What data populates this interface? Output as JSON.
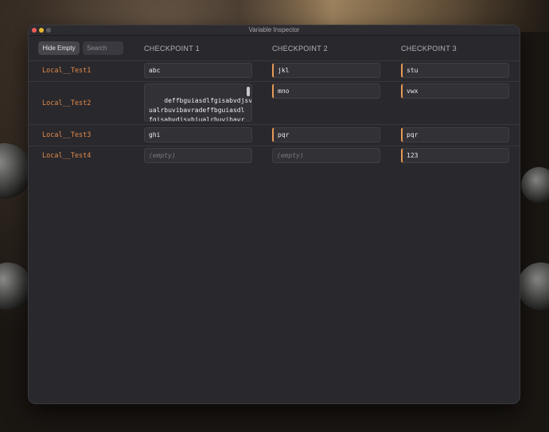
{
  "window": {
    "title": "Variable Inspector"
  },
  "toolbar": {
    "hide_empty_label": "Hide Empty",
    "search_placeholder": "Search",
    "search_value": ""
  },
  "columns": [
    "CHECKPOINT 1",
    "CHECKPOINT 2",
    "CHECKPOINT 3"
  ],
  "rows": [
    {
      "name": "Local__Test1",
      "cells": [
        {
          "value": "abc",
          "changed": false
        },
        {
          "value": "jkl",
          "changed": true
        },
        {
          "value": "stu",
          "changed": true
        }
      ]
    },
    {
      "name": "Local__Test2",
      "cells": [
        {
          "value": "deffbguiasdlfgisabvdjsvbi\nualrbuvibavradeffbguiasdl\nfgisabvdjsvbiualrbuvibavr\nadeffbguiasdlfgisabvdjsvb",
          "changed": false
        },
        {
          "value": "mno",
          "changed": true
        },
        {
          "value": "vwx",
          "changed": true
        }
      ]
    },
    {
      "name": "Local__Test3",
      "cells": [
        {
          "value": "ghi",
          "changed": false
        },
        {
          "value": "pqr",
          "changed": true
        },
        {
          "value": "pqr",
          "changed": true
        }
      ]
    },
    {
      "name": "Local__Test4",
      "cells": [
        {
          "value": "(empty)",
          "changed": false,
          "empty": true
        },
        {
          "value": "(empty)",
          "changed": false,
          "empty": true
        },
        {
          "value": "123",
          "changed": true
        }
      ]
    }
  ],
  "colors": {
    "accent": "#e38b49",
    "changed_marker": "#e89a55",
    "window_bg": "#29282d"
  }
}
